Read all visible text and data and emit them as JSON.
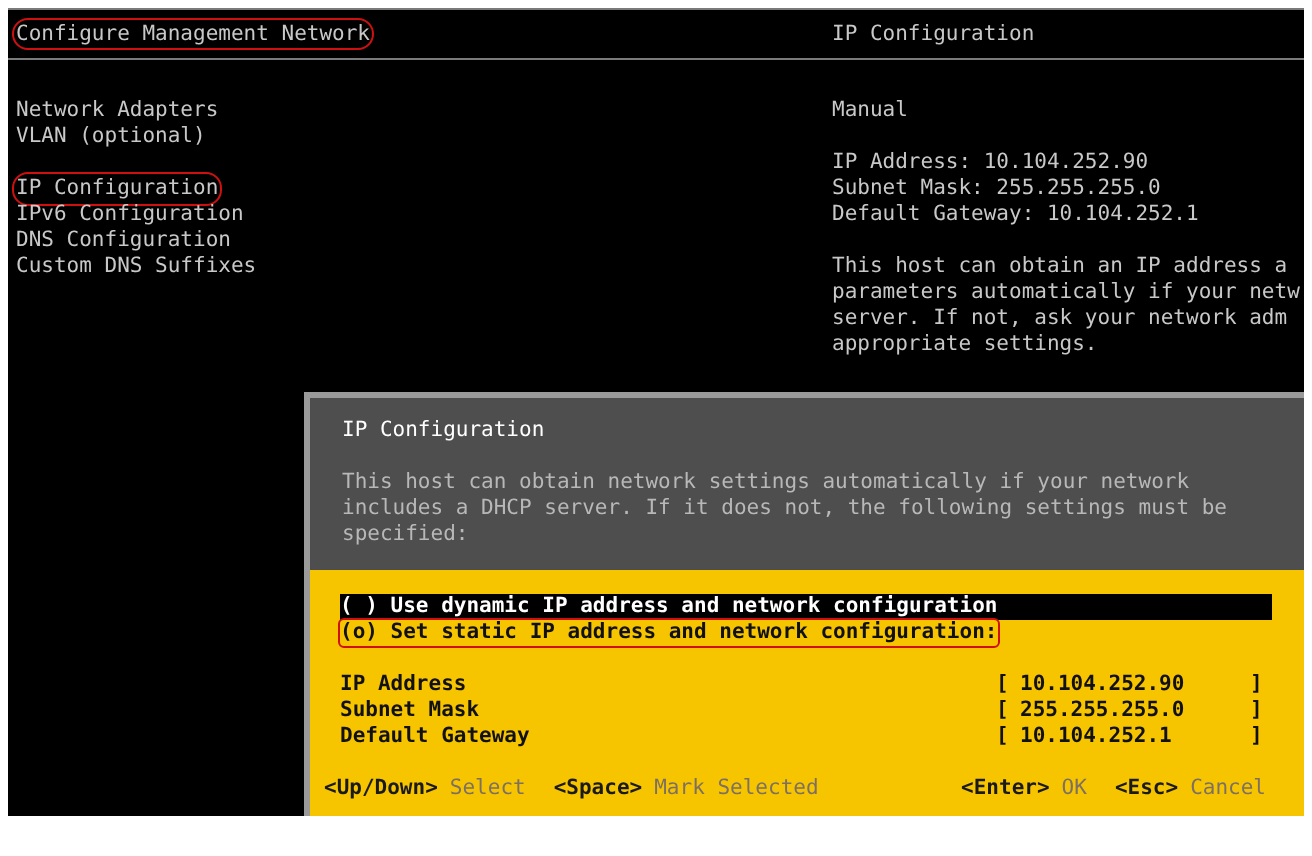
{
  "header": {
    "title": "Configure Management Network",
    "title_annotated": true,
    "panel_title": "IP Configuration"
  },
  "menu": [
    {
      "items": [
        {
          "label": "Network Adapters",
          "annotated": false
        },
        {
          "label": "VLAN (optional)",
          "annotated": false
        }
      ]
    },
    {
      "items": [
        {
          "label": "IP Configuration",
          "annotated": true
        },
        {
          "label": "IPv6 Configuration",
          "annotated": false
        },
        {
          "label": "DNS Configuration",
          "annotated": false
        },
        {
          "label": "Custom DNS Suffixes",
          "annotated": false
        }
      ]
    }
  ],
  "info": {
    "mode": "Manual",
    "details": [
      "IP Address: 10.104.252.90",
      "Subnet Mask: 255.255.255.0",
      "Default Gateway: 10.104.252.1"
    ],
    "description_lines": [
      "This host can obtain an IP address a",
      "parameters automatically if your netw",
      "server. If not, ask your network adm",
      "appropriate settings."
    ]
  },
  "dialog": {
    "title": "IP Configuration",
    "description": "This host can obtain network settings automatically if your network includes a DHCP server. If it does not, the following settings must be specified:",
    "options": [
      {
        "label": "( ) Use dynamic IP address and network configuration",
        "focused": true,
        "annotated": false
      },
      {
        "label": "(o) Set static IP address and network configuration:",
        "focused": false,
        "annotated": true
      }
    ],
    "fields": [
      {
        "label": "IP Address",
        "bracket_open": "[",
        "value": "10.104.252.90",
        "bracket_close": "]"
      },
      {
        "label": "Subnet Mask",
        "bracket_open": "[",
        "value": "255.255.255.0",
        "bracket_close": "]"
      },
      {
        "label": "Default Gateway",
        "bracket_open": "[",
        "value": "10.104.252.1",
        "bracket_close": "]"
      }
    ],
    "footer_left": [
      {
        "key": "<Up/Down>",
        "action": "Select"
      },
      {
        "key": "<Space>",
        "action": "Mark Selected"
      }
    ],
    "footer_right": [
      {
        "key": "<Enter>",
        "action": "OK"
      },
      {
        "key": "<Esc>",
        "action": "Cancel"
      }
    ]
  }
}
